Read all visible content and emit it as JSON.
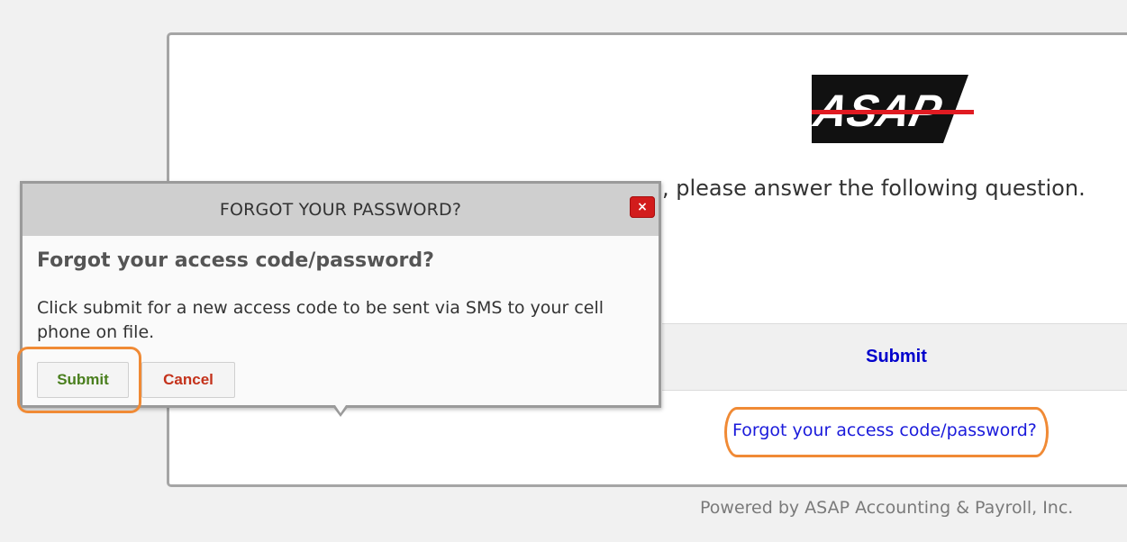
{
  "brand": {
    "logo_text": "ASAP",
    "logo_bg": "#111111",
    "logo_stripe": "#e01b22"
  },
  "main": {
    "question_text": ", please answer the following question.",
    "submit_label": "Submit",
    "forgot_link": "Forgot your access code/password?"
  },
  "footer": {
    "text": "Powered by ASAP Accounting & Payroll, Inc."
  },
  "dialog": {
    "title": "FORGOT YOUR PASSWORD?",
    "close_glyph": "×",
    "heading": "Forgot your access code/password?",
    "body": "Click submit for a new access code to be sent via SMS to your cell phone on file.",
    "submit_label": "Submit",
    "cancel_label": "Cancel"
  },
  "colors": {
    "highlight_ring": "#f08a35",
    "link": "#1a1adb",
    "submit_green": "#4a7f1e",
    "cancel_red": "#c4321b"
  }
}
